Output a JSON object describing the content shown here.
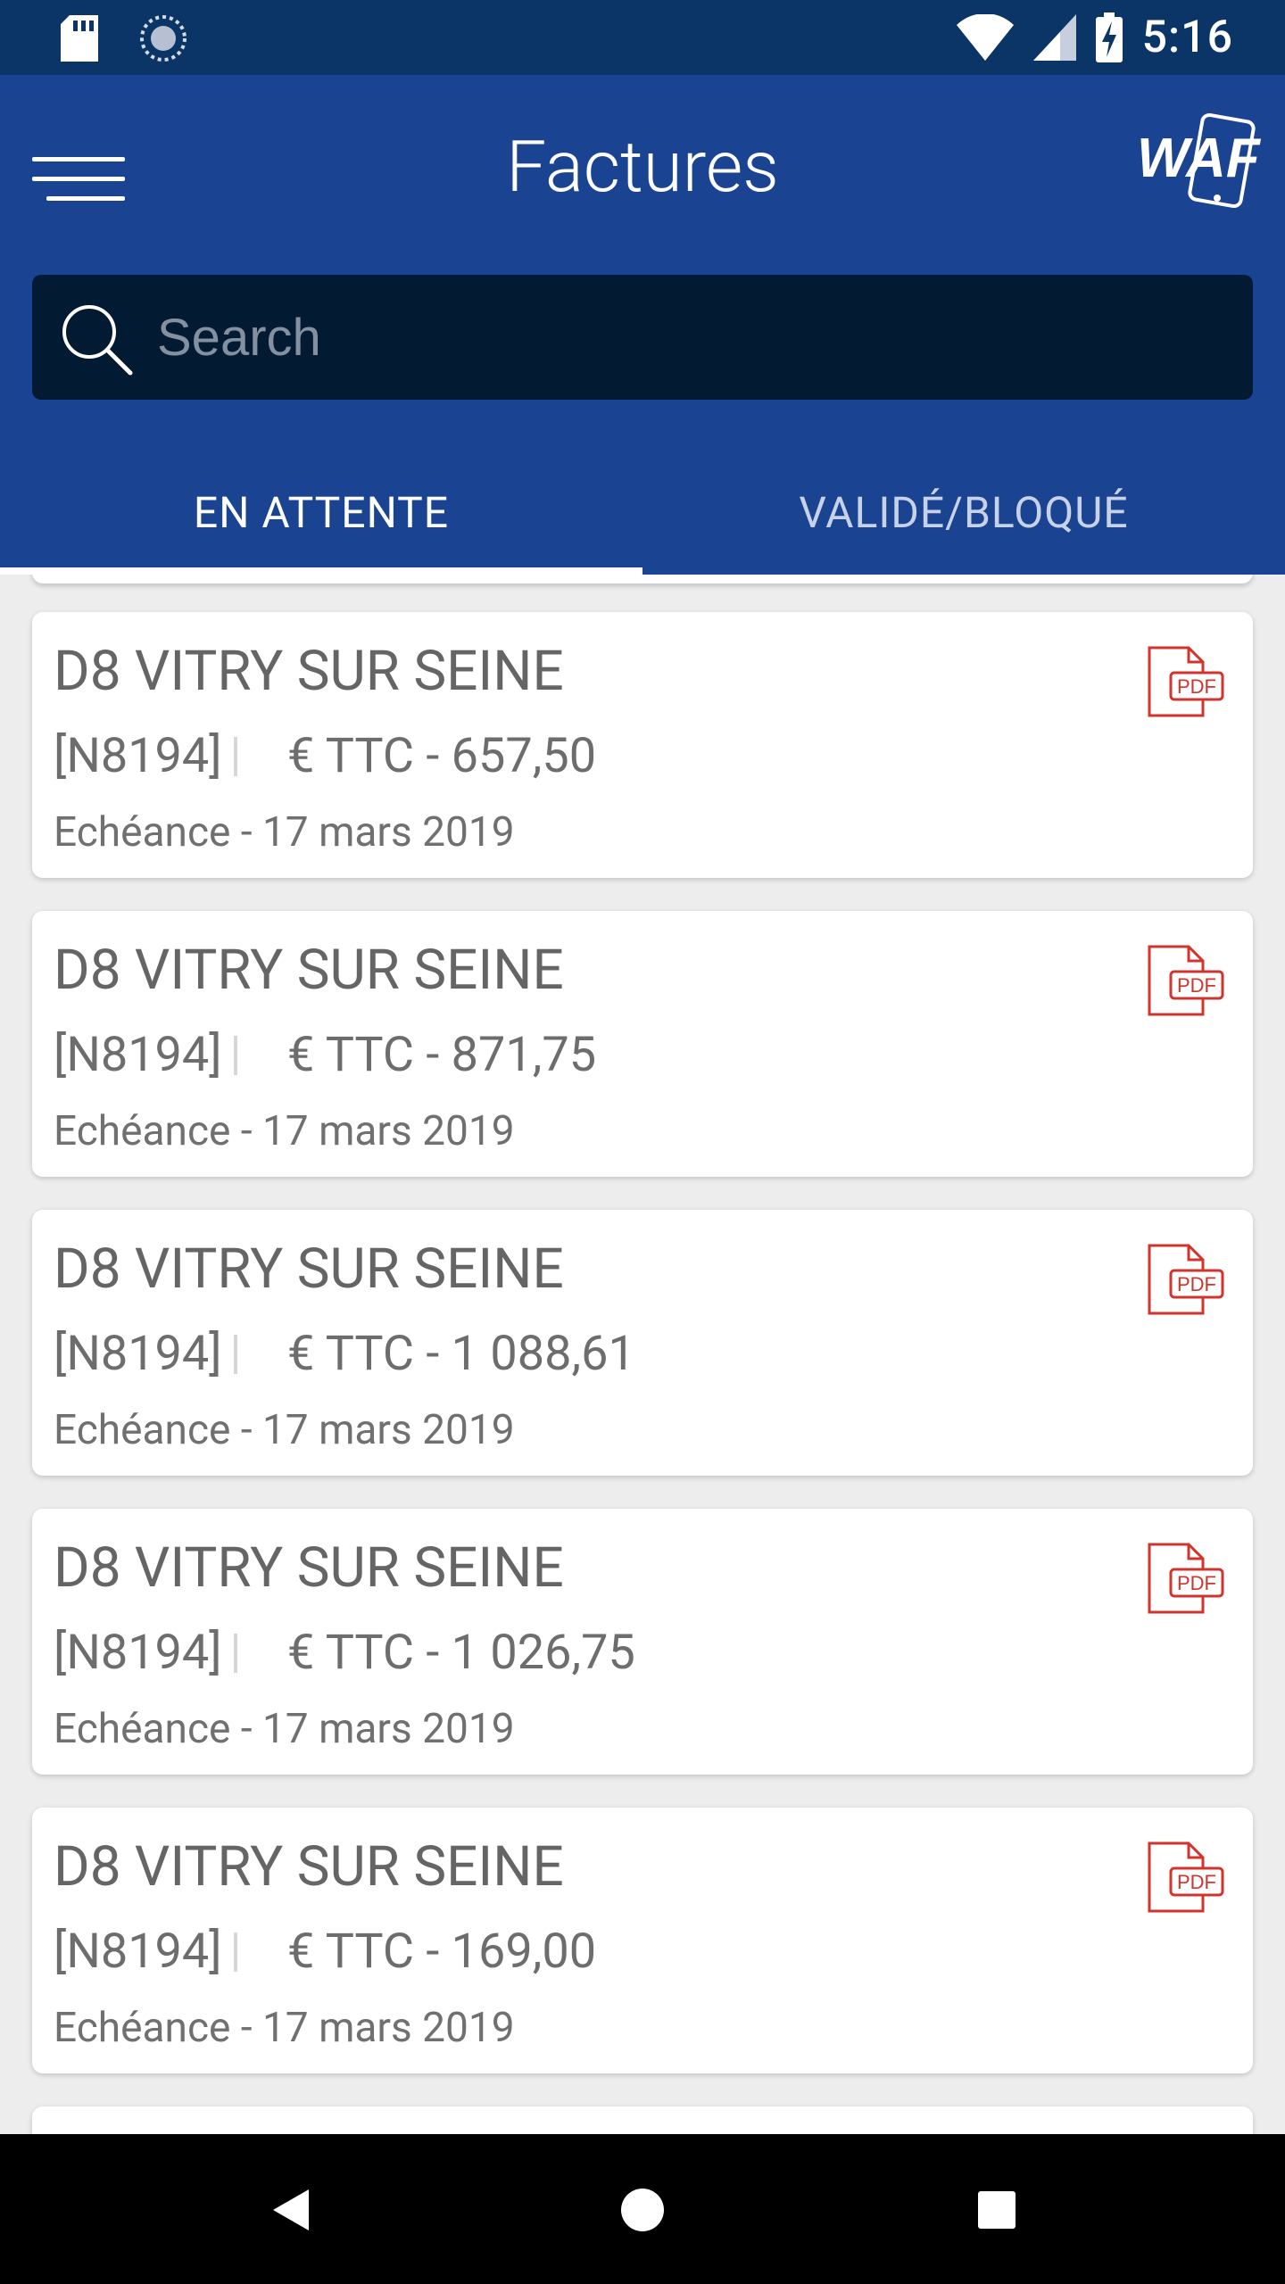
{
  "status_bar": {
    "time": "5:16",
    "icons": [
      "sd-card-icon",
      "sync-icon",
      "wifi-icon",
      "signal-icon",
      "battery-charging-icon"
    ]
  },
  "app_bar": {
    "title": "Factures",
    "logo_text": "WAF",
    "menu_icon": "hamburger-menu-icon"
  },
  "search": {
    "placeholder": "Search",
    "value": ""
  },
  "tabs": [
    {
      "label": "EN ATTENTE",
      "active": true
    },
    {
      "label": "VALIDÉ/BLOQUÉ",
      "active": false
    }
  ],
  "invoices": [
    {
      "title": "D8  VITRY SUR SEINE",
      "ref": "[N8194]",
      "amount": "€ TTC - 657,50",
      "due": "Echéance - 17 mars 2019",
      "doc": "PDF"
    },
    {
      "title": "D8  VITRY SUR SEINE",
      "ref": "[N8194]",
      "amount": "€ TTC - 871,75",
      "due": "Echéance - 17 mars 2019",
      "doc": "PDF"
    },
    {
      "title": "D8  VITRY SUR SEINE",
      "ref": "[N8194]",
      "amount": "€ TTC - 1 088,61",
      "due": "Echéance - 17 mars 2019",
      "doc": "PDF"
    },
    {
      "title": "D8  VITRY SUR SEINE",
      "ref": "[N8194]",
      "amount": "€ TTC - 1 026,75",
      "due": "Echéance - 17 mars 2019",
      "doc": "PDF"
    },
    {
      "title": "D8  VITRY SUR SEINE",
      "ref": "[N8194]",
      "amount": "€ TTC - 169,00",
      "due": "Echéance - 17 mars 2019",
      "doc": "PDF"
    }
  ],
  "colors": {
    "status_bar": "#0a3566",
    "app_bar": "#1a4391",
    "search_bg": "#031a33",
    "pdf_red": "#d0342c"
  },
  "nav_bar": {
    "icons": [
      "back-icon",
      "home-icon",
      "recents-icon"
    ]
  }
}
